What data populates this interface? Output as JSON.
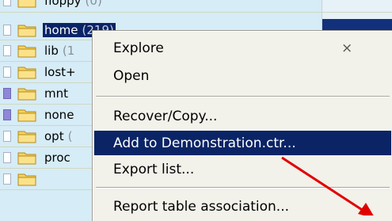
{
  "tree": {
    "rows": [
      {
        "name": "floppy",
        "count": "(0)"
      },
      {
        "name": "home",
        "count": "(219)"
      },
      {
        "name": "lib",
        "count": "(1"
      },
      {
        "name": "lost+",
        "count": ""
      },
      {
        "name": "mnt",
        "count": ""
      },
      {
        "name": "none",
        "count": ""
      },
      {
        "name": "opt",
        "count": "("
      },
      {
        "name": "proc",
        "count": ""
      },
      {
        "name": "",
        "count": ""
      }
    ]
  },
  "context_menu": {
    "items": [
      {
        "label": "Explore",
        "shortcut": "×"
      },
      {
        "label": "Open"
      },
      {
        "label": "Recover/Copy..."
      },
      {
        "label": "Add to Demonstration.ctr..."
      },
      {
        "label": "Export list..."
      },
      {
        "label": "Report table association..."
      }
    ]
  },
  "colors": {
    "selection": "#0a2466",
    "annotation_arrow": "#e10000",
    "panel_bg": "#d6ecf6",
    "menu_bg": "#f2f1ea"
  }
}
